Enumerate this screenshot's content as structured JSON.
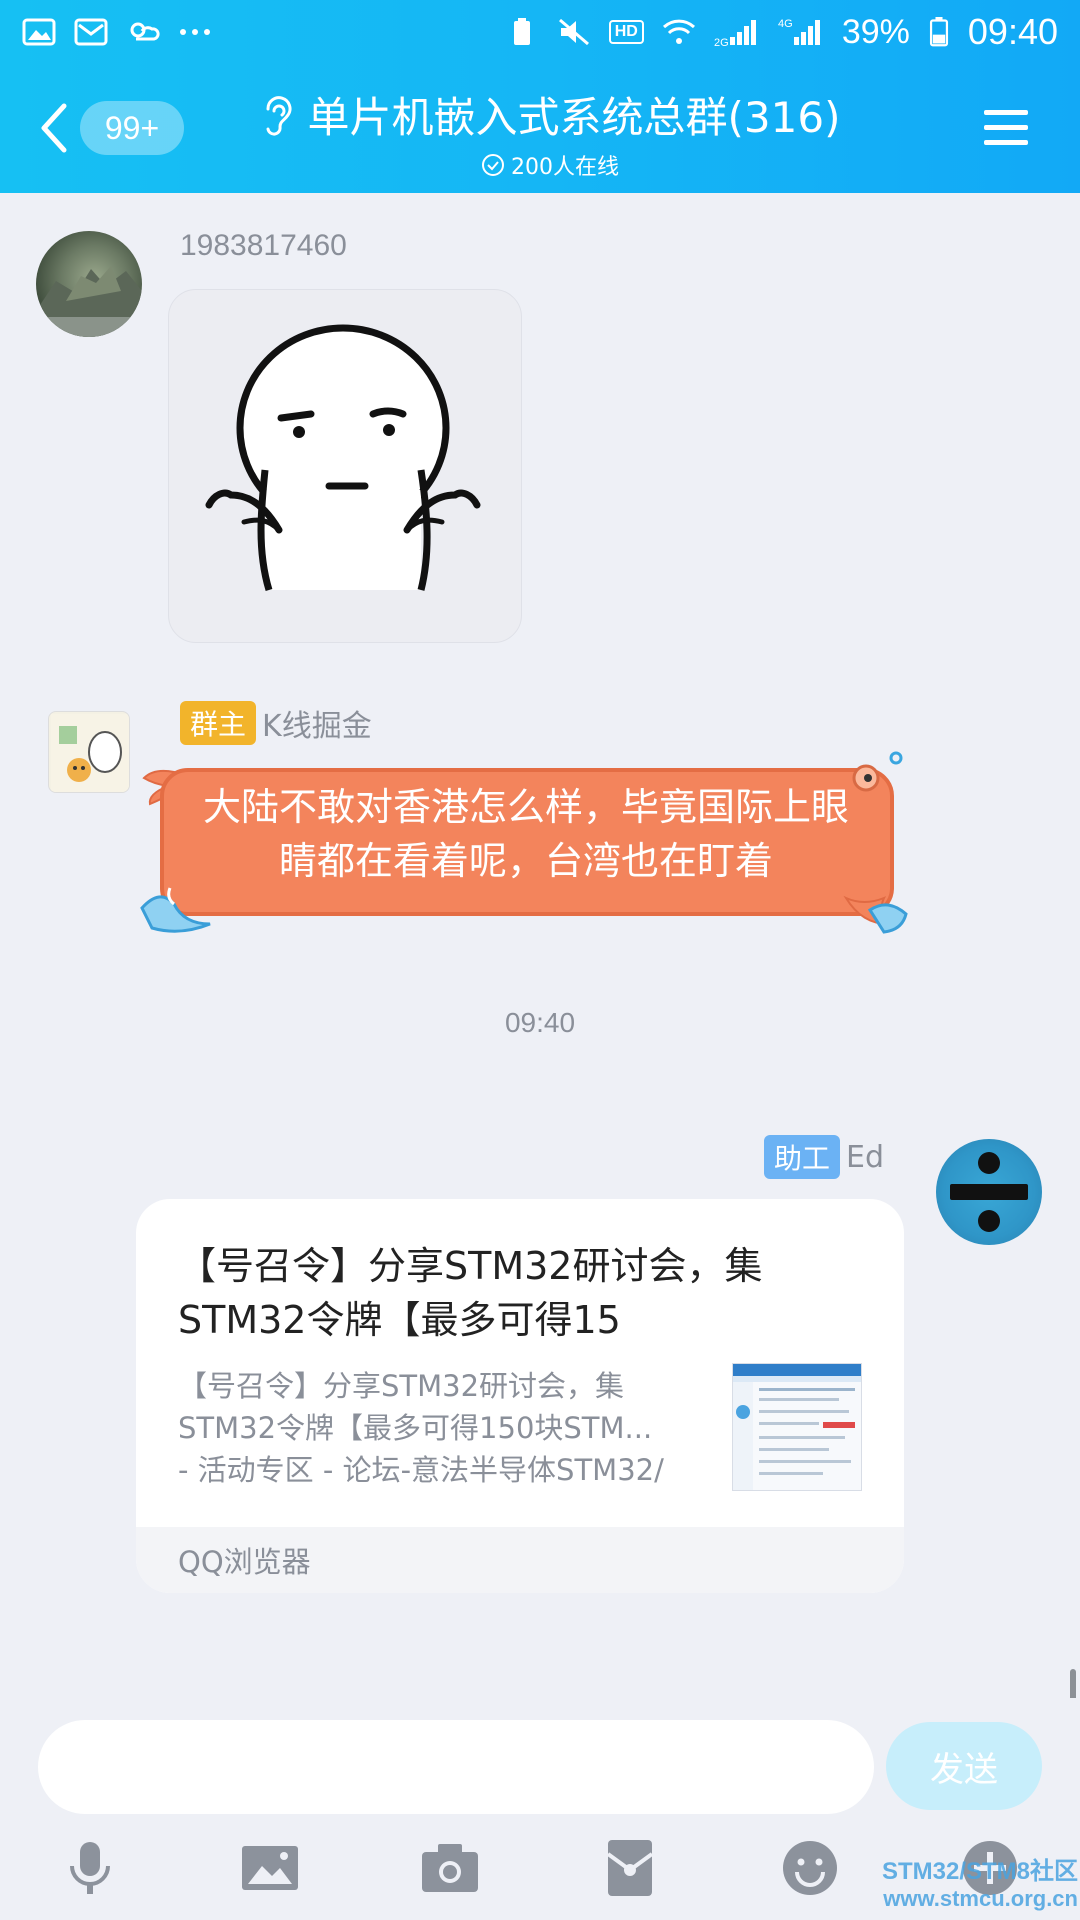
{
  "status_bar": {
    "left_icons": [
      "gallery-icon",
      "mail-icon",
      "weather-icon",
      "more-dots-icon"
    ],
    "right_icons": [
      "battery-saver-icon",
      "mute-icon",
      "hd-icon",
      "wifi-icon",
      "signal-2g-icon",
      "signal-4g-icon"
    ],
    "hd_label": "HD",
    "net_2g": "2G",
    "net_4g": "4G",
    "battery": "39%",
    "time": "09:40"
  },
  "header": {
    "back_badge": "99+",
    "title": "单片机嵌入式系统总群(316)",
    "online": "200人在线",
    "background": "#16b8f4"
  },
  "messages": [
    {
      "sender": "1983817460",
      "type": "sticker",
      "sticker": "shrug-face-sticker"
    },
    {
      "role": "群主",
      "sender": "K线掘金",
      "type": "fish-bubble",
      "text": "大陆不敢对香港怎么样，毕竟国际上眼睛都在看着呢，台湾也在盯着",
      "bubble_color": "#f3845c"
    },
    {
      "type": "time",
      "text": "09:40"
    },
    {
      "role": "助工",
      "sender": "Ed",
      "type": "share-card",
      "title": "【号召令】分享STM32研讨会，集STM32令牌【最多可得15",
      "desc_lines": [
        "【号召令】分享STM32研讨会，集",
        "STM32令牌【最多可得150块STM...",
        "- 活动专区 - 论坛-意法半导体STM32/"
      ],
      "source": "QQ浏览器"
    }
  ],
  "input": {
    "placeholder": "",
    "send_label": "发送"
  },
  "toolbar": [
    "microphone-icon",
    "image-icon",
    "camera-icon",
    "red-packet-icon",
    "emoji-icon",
    "plus-icon"
  ],
  "watermark": {
    "line1": "STM32/STM8社区",
    "line2": "www.stmcu.org.cn"
  }
}
